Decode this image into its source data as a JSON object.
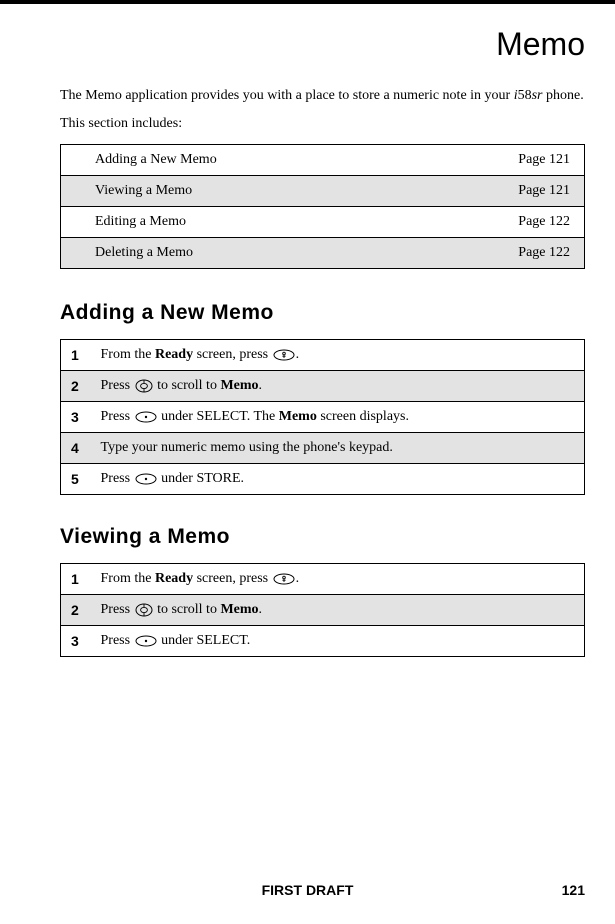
{
  "title": "Memo",
  "intro": {
    "prefix": "The Memo application provides you with a place to store a numeric note in your ",
    "model_i": "i",
    "model_num": "58",
    "model_sr": "sr",
    "suffix": " phone."
  },
  "section_includes": "This section includes:",
  "toc": [
    {
      "topic": "Adding a New Memo",
      "page": "Page 121"
    },
    {
      "topic": "Viewing a Memo",
      "page": "Page 121"
    },
    {
      "topic": "Editing a Memo",
      "page": "Page 122"
    },
    {
      "topic": "Deleting a Memo",
      "page": "Page 122"
    }
  ],
  "sections": {
    "adding": {
      "heading": "Adding a New Memo",
      "steps": [
        {
          "n": "1",
          "parts": [
            {
              "t": "text",
              "v": "From the "
            },
            {
              "t": "bold",
              "v": "Ready"
            },
            {
              "t": "text",
              "v": " screen, press "
            },
            {
              "t": "icon",
              "v": "menu-key-icon"
            },
            {
              "t": "text",
              "v": "."
            }
          ]
        },
        {
          "n": "2",
          "parts": [
            {
              "t": "text",
              "v": "Press "
            },
            {
              "t": "icon",
              "v": "nav-key-icon"
            },
            {
              "t": "text",
              "v": " to scroll to "
            },
            {
              "t": "bold",
              "v": "Memo"
            },
            {
              "t": "text",
              "v": "."
            }
          ]
        },
        {
          "n": "3",
          "parts": [
            {
              "t": "text",
              "v": "Press "
            },
            {
              "t": "icon",
              "v": "soft-key-icon"
            },
            {
              "t": "text",
              "v": " under SELECT. The "
            },
            {
              "t": "bold",
              "v": "Memo"
            },
            {
              "t": "text",
              "v": " screen displays."
            }
          ]
        },
        {
          "n": "4",
          "parts": [
            {
              "t": "text",
              "v": "Type your numeric memo using the phone's keypad."
            }
          ]
        },
        {
          "n": "5",
          "parts": [
            {
              "t": "text",
              "v": "Press "
            },
            {
              "t": "icon",
              "v": "soft-key-icon"
            },
            {
              "t": "text",
              "v": " under STORE."
            }
          ]
        }
      ]
    },
    "viewing": {
      "heading": "Viewing a Memo",
      "steps": [
        {
          "n": "1",
          "parts": [
            {
              "t": "text",
              "v": "From the "
            },
            {
              "t": "bold",
              "v": "Ready"
            },
            {
              "t": "text",
              "v": " screen, press "
            },
            {
              "t": "icon",
              "v": "menu-key-icon"
            },
            {
              "t": "text",
              "v": "."
            }
          ]
        },
        {
          "n": "2",
          "parts": [
            {
              "t": "text",
              "v": "Press "
            },
            {
              "t": "icon",
              "v": "nav-key-icon"
            },
            {
              "t": "text",
              "v": " to scroll to "
            },
            {
              "t": "bold",
              "v": "Memo"
            },
            {
              "t": "text",
              "v": "."
            }
          ]
        },
        {
          "n": "3",
          "parts": [
            {
              "t": "text",
              "v": "Press "
            },
            {
              "t": "icon",
              "v": "soft-key-icon"
            },
            {
              "t": "text",
              "v": " under SELECT."
            }
          ]
        }
      ]
    }
  },
  "footer": {
    "draft": "FIRST DRAFT",
    "page": "121"
  }
}
